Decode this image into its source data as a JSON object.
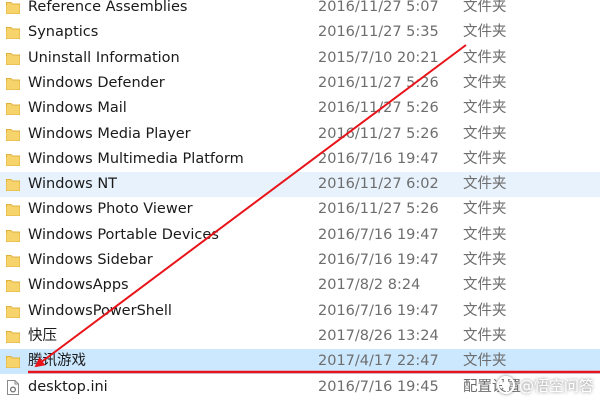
{
  "colors": {
    "folder": "#f7d36b",
    "folder_dark": "#e0b23c",
    "hover_row": "#e8f2fc",
    "selected_row": "#cce8ff",
    "annotation_red": "#e8141a"
  },
  "files": [
    {
      "name": "Reference Assemblies",
      "date": "2016/11/27 5:07",
      "type": "文件夹",
      "icon": "folder-icon",
      "state": ""
    },
    {
      "name": "Synaptics",
      "date": "2016/11/27 5:35",
      "type": "文件夹",
      "icon": "folder-icon",
      "state": ""
    },
    {
      "name": "Uninstall Information",
      "date": "2015/7/10 20:21",
      "type": "文件夹",
      "icon": "folder-icon",
      "state": ""
    },
    {
      "name": "Windows Defender",
      "date": "2016/11/27 5:26",
      "type": "文件夹",
      "icon": "folder-icon",
      "state": ""
    },
    {
      "name": "Windows Mail",
      "date": "2016/11/27 5:26",
      "type": "文件夹",
      "icon": "folder-icon",
      "state": ""
    },
    {
      "name": "Windows Media Player",
      "date": "2016/11/27 5:26",
      "type": "文件夹",
      "icon": "folder-icon",
      "state": ""
    },
    {
      "name": "Windows Multimedia Platform",
      "date": "2016/7/16 19:47",
      "type": "文件夹",
      "icon": "folder-icon",
      "state": ""
    },
    {
      "name": "Windows NT",
      "date": "2016/11/27 6:02",
      "type": "文件夹",
      "icon": "folder-icon",
      "state": "hover"
    },
    {
      "name": "Windows Photo Viewer",
      "date": "2016/11/27 5:26",
      "type": "文件夹",
      "icon": "folder-icon",
      "state": ""
    },
    {
      "name": "Windows Portable Devices",
      "date": "2016/7/16 19:47",
      "type": "文件夹",
      "icon": "folder-icon",
      "state": ""
    },
    {
      "name": "Windows Sidebar",
      "date": "2016/7/16 19:47",
      "type": "文件夹",
      "icon": "folder-icon",
      "state": ""
    },
    {
      "name": "WindowsApps",
      "date": "2017/8/2 8:24",
      "type": "文件夹",
      "icon": "folder-icon",
      "state": ""
    },
    {
      "name": "WindowsPowerShell",
      "date": "2016/7/16 19:47",
      "type": "文件夹",
      "icon": "folder-icon",
      "state": ""
    },
    {
      "name": "快压",
      "date": "2017/8/26 13:24",
      "type": "文件夹",
      "icon": "folder-icon",
      "state": ""
    },
    {
      "name": "腾讯游戏",
      "date": "2017/4/17 22:47",
      "type": "文件夹",
      "icon": "folder-icon",
      "state": "selected"
    },
    {
      "name": "desktop.ini",
      "date": "2016/7/16 19:45",
      "type": "配置设置",
      "icon": "settings-file-icon",
      "state": ""
    }
  ],
  "watermark": {
    "text": "@悟空问答",
    "icon": "wukong-logo-icon"
  }
}
